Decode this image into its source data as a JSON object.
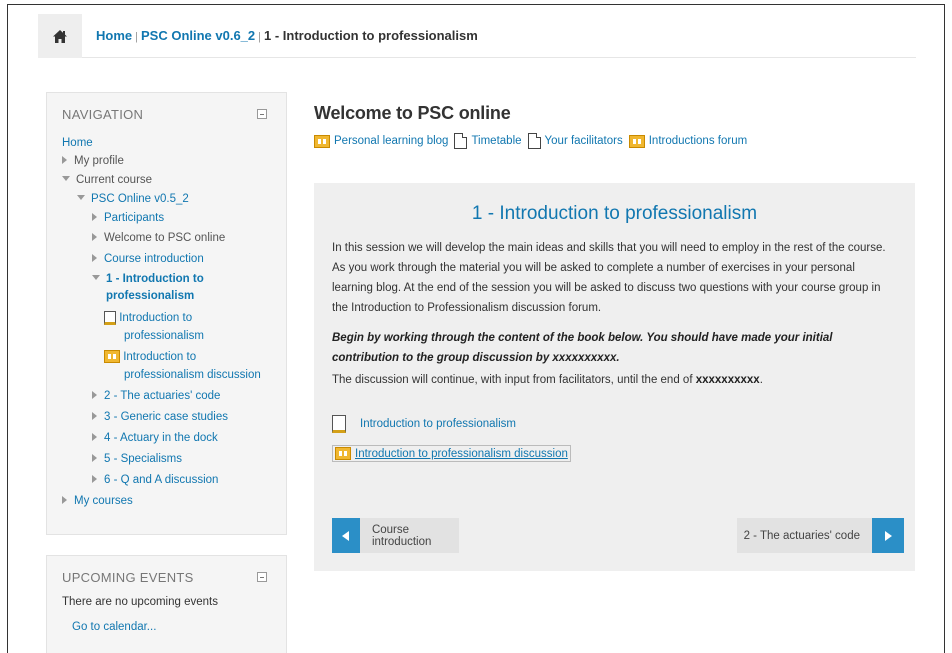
{
  "breadcrumb": {
    "home": "Home",
    "sep": "|",
    "course": "PSC Online v0.6_2",
    "current": "1 - Introduction to professionalism"
  },
  "navigation": {
    "title": "NAVIGATION",
    "home": "Home",
    "my_profile": "My profile",
    "current_course": "Current course",
    "course_name": "PSC Online v0.5_2",
    "participants": "Participants",
    "welcome": "Welcome to PSC online",
    "course_intro": "Course introduction",
    "section1_line1": "1 - Introduction to",
    "section1_line2": "professionalism",
    "book_line1": "Introduction to",
    "book_line2": "professionalism",
    "forum_line1": "Introduction to",
    "forum_line2": "professionalism discussion",
    "s2": "2 - The actuaries' code",
    "s3": "3 - Generic case studies",
    "s4": "4 - Actuary in the dock",
    "s5": "5 - Specialisms",
    "s6": "6 - Q and A discussion",
    "my_courses": "My courses"
  },
  "events": {
    "title": "UPCOMING EVENTS",
    "empty": "There are no upcoming events",
    "calendar_link": "Go to calendar..."
  },
  "main": {
    "title": "Welcome to PSC online",
    "activities": [
      {
        "label": "Personal learning blog",
        "icon": "forum-icon"
      },
      {
        "label": "Timetable",
        "icon": "page-icon"
      },
      {
        "label": "Your facilitators",
        "icon": "page-icon"
      },
      {
        "label": "Introductions forum",
        "icon": "forum-icon"
      }
    ],
    "section": {
      "title": "1 - Introduction to professionalism",
      "summary": "In this session we will develop the main ideas and skills that you will need to employ in the rest of the course. As you work through the material you will be asked to complete a number of exercises in your personal learning blog. At the end of the session you will be asked to discuss two questions with your course group in the Introduction to Professionalism discussion forum.",
      "emphasis": "Begin by working through the content of the book below. You should have made your initial contribution to the group discussion by xxxxxxxxxx.",
      "note_prefix": "The discussion will continue, with input from facilitators, until the end of ",
      "note_bold": "xxxxxxxxxx",
      "note_suffix": ".",
      "book_activity": "Introduction to professionalism",
      "forum_activity": "Introduction to professionalism discussion",
      "prev_label": "Course introduction",
      "next_label": "2 - The actuaries' code"
    }
  },
  "colors": {
    "link": "#1177b0",
    "accent": "#2b8fc7",
    "forum_icon": "#f0b730"
  }
}
